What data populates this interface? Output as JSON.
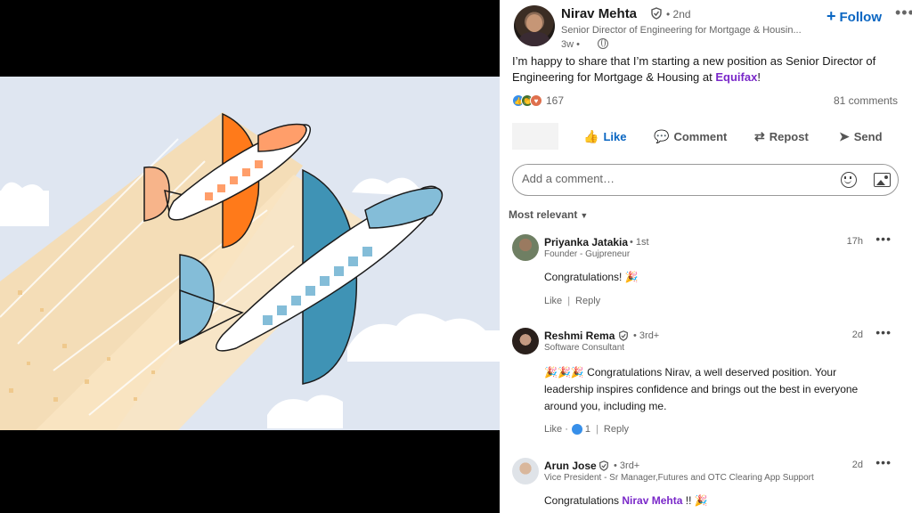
{
  "post": {
    "author": {
      "name": "Nirav Mehta",
      "degree": "• 2nd",
      "headline": "Senior Director of Engineering for Mortgage & Housin...",
      "time": "3w •"
    },
    "follow_label": "Follow",
    "follow_icon": "+",
    "more_label": "•••",
    "text_main": "I’m happy to share that I’m starting a new position as Senior Director of Engineering for Mortgage & Housing at ",
    "text_company": "Equifax",
    "text_end": "!",
    "reaction_count": "167",
    "comments_count": "81 comments",
    "actions": {
      "like": "Like",
      "comment": "Comment",
      "repost": "Repost",
      "send": "Send"
    },
    "comment_placeholder": "Add a comment…",
    "sort_label": "Most relevant"
  },
  "comments": [
    {
      "name": "Priyanka Jatakia",
      "degree": "• 1st",
      "headline": "Founder - Gujpreneur",
      "time": "17h",
      "text": "Congratulations! 🎉",
      "like_label": "Like",
      "reply_label": "Reply"
    },
    {
      "name": "Reshmi Rema",
      "degree": "• 3rd+",
      "headline": "Software Consultant",
      "time": "2d",
      "text": "🎉🎉🎉 Congratulations Nirav, a well deserved position. Your leadership inspires confidence and brings out the best in everyone around you, including me.",
      "like_label": "Like ·",
      "like_count": "1",
      "reply_label": "Reply"
    },
    {
      "name": "Arun Jose",
      "degree": "• 3rd+",
      "headline": "Vice President - Sr Manager,Futures and OTC Clearing App Support",
      "time": "2d",
      "text_prefix": "Congratulations ",
      "mention": "Nirav Mehta",
      "text_suffix": " !! 🎉"
    }
  ],
  "colors": {
    "accent": "#0a66c2",
    "mention": "#7a28c9",
    "plane_orange": "#ff7a1a",
    "plane_blue": "#3f93b5"
  }
}
